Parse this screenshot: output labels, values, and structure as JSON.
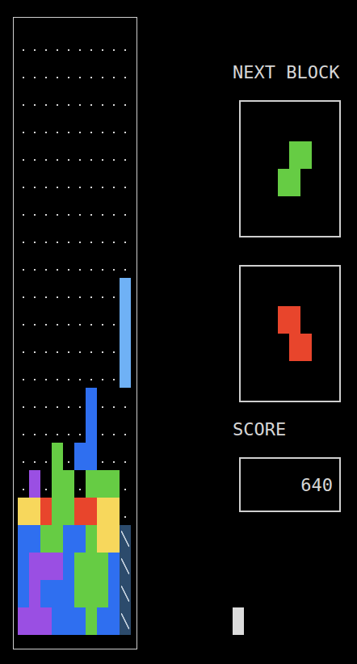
{
  "board": {
    "rows": [
      "..........",
      "..........",
      "..........",
      "..........",
      "..........",
      "..........",
      "..........",
      "..........",
      "..........",
      ".........L",
      ".........L",
      ".........L",
      ".........L",
      "......B...",
      "......B...",
      "...G.BB...",
      ".P.GG.GGG.",
      "YYRGGRRYY.",
      "BBGGBBGYYH",
      "BPPPBGGGBH",
      "BPBBBGGGBH",
      "PPPBBBGBBH"
    ],
    "colors": {
      "L": "#6fb1f5",
      "B": "#2f6ff0",
      "G": "#66cc44",
      "Y": "#f7d75c",
      "R": "#e8452c",
      "P": "#9a4fe3",
      "H": "#2c4b6c"
    },
    "hatched": "H"
  },
  "next_label": "NEXT BLOCK",
  "next_blocks": [
    {
      "shape": [
        ".GG",
        "GG."
      ],
      "color": "#66cc44"
    },
    {
      "shape": [
        "RR.",
        ".RR"
      ],
      "color": "#e8452c"
    }
  ],
  "score_label": "SCORE",
  "score": "640"
}
